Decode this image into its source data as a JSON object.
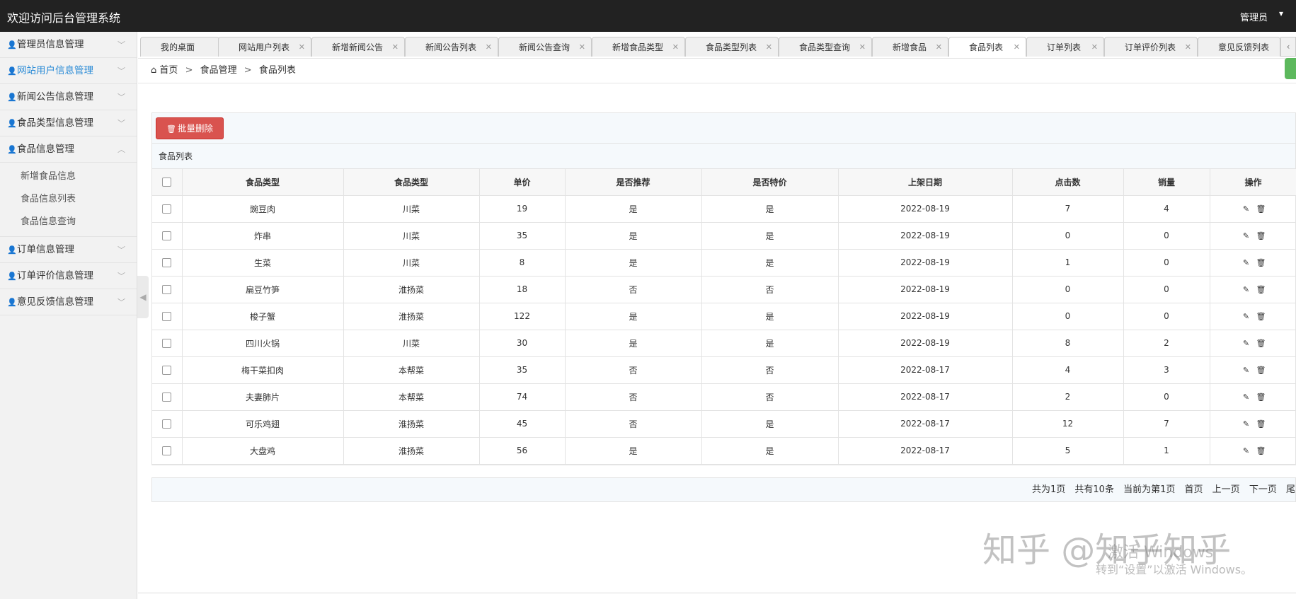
{
  "app": {
    "title": "欢迎访问后台管理系统",
    "user": "管理员"
  },
  "sidebar": {
    "items": [
      {
        "label": "管理员信息管理"
      },
      {
        "label": "网站用户信息管理"
      },
      {
        "label": "新闻公告信息管理"
      },
      {
        "label": "食品类型信息管理"
      },
      {
        "label": "食品信息管理"
      },
      {
        "label": "订单信息管理"
      },
      {
        "label": "订单评价信息管理"
      },
      {
        "label": "意见反馈信息管理"
      }
    ],
    "submenu": [
      {
        "label": "新增食品信息"
      },
      {
        "label": "食品信息列表"
      },
      {
        "label": "食品信息查询"
      }
    ]
  },
  "tabs": [
    {
      "label": "我的桌面"
    },
    {
      "label": "网站用户列表"
    },
    {
      "label": "新增新闻公告"
    },
    {
      "label": "新闻公告列表"
    },
    {
      "label": "新闻公告查询"
    },
    {
      "label": "新增食品类型"
    },
    {
      "label": "食品类型列表"
    },
    {
      "label": "食品类型查询"
    },
    {
      "label": "新增食品"
    },
    {
      "label": "食品列表"
    },
    {
      "label": "订单列表"
    },
    {
      "label": "订单评价列表"
    },
    {
      "label": "意见反馈列表"
    }
  ],
  "breadcrumb": {
    "home": "首页",
    "level1": "食品管理",
    "level2": "食品列表"
  },
  "toolbar": {
    "batch_delete": "批量删除"
  },
  "list": {
    "title": "食品列表",
    "columns": [
      "食品类型",
      "食品类型",
      "单价",
      "是否推荐",
      "是否特价",
      "上架日期",
      "点击数",
      "销量",
      "操作"
    ],
    "rows": [
      [
        "豌豆肉",
        "川菜",
        "19",
        "是",
        "是",
        "2022-08-19",
        "7",
        "4"
      ],
      [
        "炸串",
        "川菜",
        "35",
        "是",
        "是",
        "2022-08-19",
        "0",
        "0"
      ],
      [
        "生菜",
        "川菜",
        "8",
        "是",
        "是",
        "2022-08-19",
        "1",
        "0"
      ],
      [
        "扁豆竹笋",
        "淮扬菜",
        "18",
        "否",
        "否",
        "2022-08-19",
        "0",
        "0"
      ],
      [
        "梭子蟹",
        "淮扬菜",
        "122",
        "是",
        "是",
        "2022-08-19",
        "0",
        "0"
      ],
      [
        "四川火锅",
        "川菜",
        "30",
        "是",
        "是",
        "2022-08-19",
        "8",
        "2"
      ],
      [
        "梅干菜扣肉",
        "本帮菜",
        "35",
        "否",
        "否",
        "2022-08-17",
        "4",
        "3"
      ],
      [
        "夫妻肺片",
        "本帮菜",
        "74",
        "否",
        "否",
        "2022-08-17",
        "2",
        "0"
      ],
      [
        "可乐鸡翅",
        "淮扬菜",
        "45",
        "否",
        "是",
        "2022-08-17",
        "12",
        "7"
      ],
      [
        "大盘鸡",
        "淮扬菜",
        "56",
        "是",
        "是",
        "2022-08-17",
        "5",
        "1"
      ]
    ]
  },
  "pager": {
    "total_pages": "共为1页",
    "total_items": "共有10条",
    "current": "当前为第1页",
    "first": "首页",
    "prev": "上一页",
    "next": "下一页",
    "last": "尾"
  },
  "watermark": {
    "brand": "知乎 @知乎知乎",
    "win1": "激活 Windows",
    "win2": "转到“设置”以激活 Windows。"
  }
}
